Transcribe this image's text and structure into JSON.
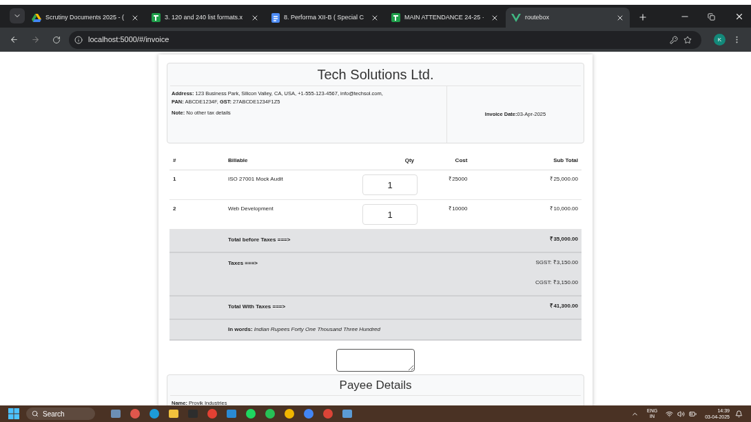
{
  "browser": {
    "tabs": [
      {
        "title": "Scrutiny Documents 2025 - (",
        "kind": "drive",
        "selected": false
      },
      {
        "title": "3. 120 and 240 list formats.x",
        "kind": "sheets",
        "selected": false
      },
      {
        "title": "8. Performa XII-B ( Special C",
        "kind": "docs",
        "selected": false
      },
      {
        "title": "MAIN ATTENDANCE 24-25 ·",
        "kind": "sheets",
        "selected": false
      },
      {
        "title": "routebox",
        "kind": "vue",
        "selected": true
      }
    ],
    "address": "localhost:5000/#/invoice",
    "profile": "K"
  },
  "invoice": {
    "company": "Tech Solutions Ltd.",
    "details": [
      {
        "lines": [
          "**Address:** 123 Business Park, Silicon Valley, CA, USA, +1-555-123-4567, info@techsol.com,",
          "**PAN:** ABCDE1234F, **GST:** 27ABCDE1234F1Z5"
        ]
      },
      {
        "lines": [
          "**Note:** No other tax details"
        ]
      }
    ],
    "date_label": "Invoice Date:",
    "date": "03-Apr-2025",
    "columns": [
      "#",
      "Billable",
      "Qty",
      "Cost",
      "Sub Total"
    ],
    "rows": [
      {
        "index": "1",
        "billable": "ISO 27001 Mock Audit",
        "qty": "1",
        "cost": "₹25000",
        "subtotal": "₹25,000.00"
      },
      {
        "index": "2",
        "billable": "Web Development",
        "qty": "1",
        "cost": "₹10000",
        "subtotal": "₹10,000.00"
      }
    ],
    "summary": [
      {
        "label": "Total before Taxes ===>",
        "values": [
          "₹35,000.00"
        ],
        "bold": true
      },
      {
        "label": "Taxes ===>",
        "values": [
          "SGST: ₹3,150.00",
          "CGST: ₹3,150.00"
        ],
        "bold": false
      },
      {
        "label": "Total With Taxes ===>",
        "values": [
          "₹41,300.00"
        ],
        "bold": true
      }
    ],
    "words": "**In words:** *Indian Rupees Forty One Thousand Three Hundred*",
    "payee_title": "Payee Details",
    "payee_name": "**Name:** Provik Industries"
  },
  "taskbar": {
    "search": "Search",
    "lang": "ENG",
    "region": "IN",
    "time": "14:39",
    "date": "03-04-2025"
  }
}
